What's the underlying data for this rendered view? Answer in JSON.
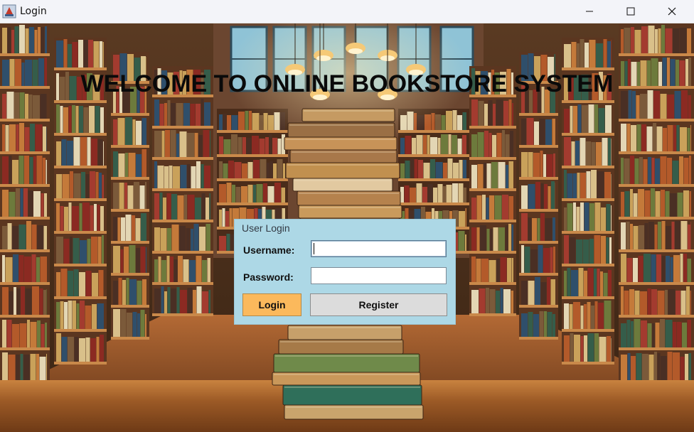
{
  "window": {
    "title": "Login",
    "controls": [
      "minimize-icon",
      "maximize-icon",
      "close-icon"
    ]
  },
  "headline": "WELCOME TO ONLINE BOOKSTORE SYSTEM",
  "login_panel": {
    "title": "User Login",
    "username_label": "Username:",
    "username_value": "",
    "password_label": "Password:",
    "password_value": "",
    "login_button": "Login",
    "register_button": "Register"
  },
  "colors": {
    "panel_background": "#add8e6",
    "login_button": "#fbb95c",
    "register_button": "#dcdcdc",
    "headline": "#0a0a0a"
  }
}
